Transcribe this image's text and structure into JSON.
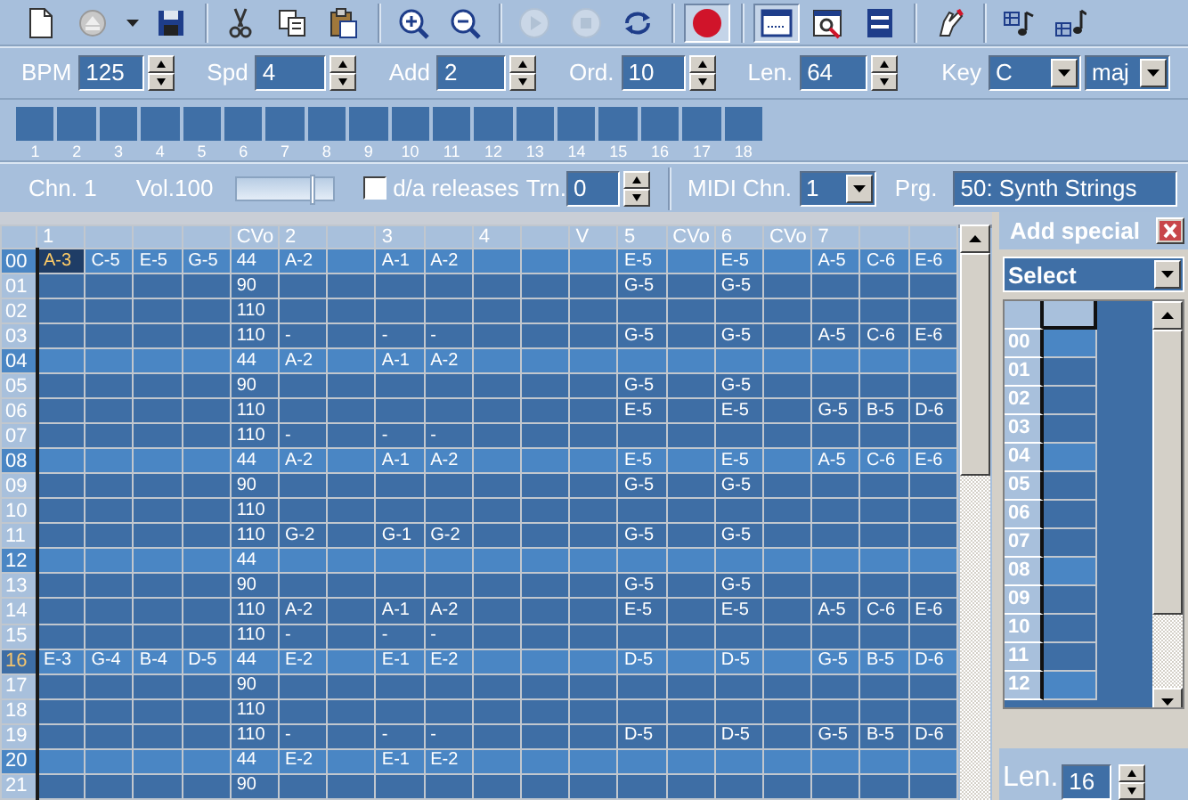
{
  "toolbar": {
    "groups": [
      {
        "buttons": [
          {
            "kind": "new",
            "pressed": false,
            "disabled": false
          },
          {
            "kind": "disc",
            "pressed": false,
            "disabled": false
          },
          {
            "kind": "caret",
            "pressed": false,
            "disabled": false
          },
          {
            "kind": "save",
            "pressed": false,
            "disabled": false
          }
        ]
      },
      {
        "buttons": [
          {
            "kind": "cut",
            "pressed": false,
            "disabled": false
          },
          {
            "kind": "copy",
            "pressed": false,
            "disabled": false
          },
          {
            "kind": "paste",
            "pressed": false,
            "disabled": false
          }
        ]
      },
      {
        "buttons": [
          {
            "kind": "zoom-in",
            "pressed": false,
            "disabled": false
          },
          {
            "kind": "zoom-out",
            "pressed": false,
            "disabled": false
          }
        ]
      },
      {
        "buttons": [
          {
            "kind": "play",
            "pressed": false,
            "disabled": true
          },
          {
            "kind": "stop",
            "pressed": false,
            "disabled": true
          },
          {
            "kind": "loop",
            "pressed": false,
            "disabled": false
          }
        ]
      },
      {
        "buttons": [
          {
            "kind": "record",
            "pressed": true,
            "disabled": false
          }
        ]
      },
      {
        "buttons": [
          {
            "kind": "pattern-view",
            "pressed": true,
            "disabled": false
          },
          {
            "kind": "window-search",
            "pressed": false,
            "disabled": false
          },
          {
            "kind": "list",
            "pressed": false,
            "disabled": false
          }
        ]
      },
      {
        "buttons": [
          {
            "kind": "hand",
            "pressed": false,
            "disabled": false
          }
        ]
      },
      {
        "buttons": [
          {
            "kind": "note",
            "pressed": false,
            "disabled": false
          },
          {
            "kind": "note-alt",
            "pressed": false,
            "disabled": false
          }
        ]
      }
    ]
  },
  "params": [
    {
      "kind": "spin",
      "label": "BPM",
      "value": "125"
    },
    {
      "kind": "spin",
      "label": "Spd",
      "value": "4"
    },
    {
      "kind": "spin",
      "label": "Add",
      "value": "2"
    },
    {
      "kind": "spin",
      "label": "Ord.",
      "value": "10"
    },
    {
      "kind": "spin",
      "label": "Len.",
      "value": "64"
    },
    {
      "kind": "select",
      "label": "Key",
      "value": "C"
    },
    {
      "kind": "select",
      "value": "maj"
    }
  ],
  "order_list": [
    "1",
    "2",
    "3",
    "4",
    "5",
    "6",
    "7",
    "8",
    "9",
    "10",
    "11",
    "12",
    "13",
    "14",
    "15",
    "16",
    "17",
    "18"
  ],
  "channel": {
    "label": "Chn. 1",
    "volume_label": "Vol.100",
    "volume": {
      "level": 0.82
    },
    "releases": {
      "label": "d/a releases",
      "checked": false
    },
    "transpose": {
      "label": "Trn.",
      "value": "0"
    },
    "midi_channel": {
      "label": "MIDI Chn.",
      "value": "1"
    },
    "program": {
      "label": "Prg.",
      "value": "50: Synth Strings"
    }
  },
  "pattern": {
    "columns": [
      {
        "label": "1"
      },
      {},
      {},
      {},
      {
        "label": "CVo"
      },
      {
        "label": "2"
      },
      {},
      {
        "label": "3"
      },
      {},
      {
        "label": "4"
      },
      {},
      {
        "label": "V"
      },
      {
        "label": "5"
      },
      {
        "label": "CVo"
      },
      {
        "label": "6"
      },
      {
        "label": "CVo"
      },
      {
        "label": "7"
      },
      {},
      {}
    ],
    "rows": [
      {
        "number": "00",
        "accent": true,
        "playing": false,
        "cells": [
          {
            "text": "A-3",
            "selected": true
          },
          {
            "text": "C-5",
            "selected": false
          },
          {
            "text": "E-5",
            "selected": false
          },
          {
            "text": "G-5",
            "selected": false
          },
          {
            "text": "44",
            "selected": false
          },
          {
            "text": "A-2",
            "selected": false
          },
          {
            "selected": false
          },
          {
            "text": "A-1",
            "selected": false
          },
          {
            "text": "A-2",
            "selected": false
          },
          {
            "selected": false
          },
          {
            "selected": false
          },
          {
            "selected": false
          },
          {
            "text": "E-5",
            "selected": false
          },
          {
            "selected": false
          },
          {
            "text": "E-5",
            "selected": false
          },
          {
            "selected": false
          },
          {
            "text": "A-5",
            "selected": false
          },
          {
            "text": "C-6",
            "selected": false
          },
          {
            "text": "E-6",
            "selected": false
          }
        ]
      },
      {
        "number": "01",
        "accent": false,
        "playing": false,
        "cells": [
          {
            "selected": false
          },
          {
            "selected": false
          },
          {
            "selected": false
          },
          {
            "selected": false
          },
          {
            "text": "90",
            "selected": false
          },
          {
            "selected": false
          },
          {
            "selected": false
          },
          {
            "selected": false
          },
          {
            "selected": false
          },
          {
            "selected": false
          },
          {
            "selected": false
          },
          {
            "selected": false
          },
          {
            "text": "G-5",
            "selected": false
          },
          {
            "selected": false
          },
          {
            "text": "G-5",
            "selected": false
          },
          {
            "selected": false
          },
          {
            "selected": false
          },
          {
            "selected": false
          },
          {
            "selected": false
          }
        ]
      },
      {
        "number": "02",
        "accent": false,
        "playing": false,
        "cells": [
          {
            "selected": false
          },
          {
            "selected": false
          },
          {
            "selected": false
          },
          {
            "selected": false
          },
          {
            "text": "110",
            "selected": false
          },
          {
            "selected": false
          },
          {
            "selected": false
          },
          {
            "selected": false
          },
          {
            "selected": false
          },
          {
            "selected": false
          },
          {
            "selected": false
          },
          {
            "selected": false
          },
          {
            "selected": false
          },
          {
            "selected": false
          },
          {
            "selected": false
          },
          {
            "selected": false
          },
          {
            "selected": false
          },
          {
            "selected": false
          },
          {
            "selected": false
          }
        ]
      },
      {
        "number": "03",
        "accent": false,
        "playing": false,
        "cells": [
          {
            "selected": false
          },
          {
            "selected": false
          },
          {
            "selected": false
          },
          {
            "selected": false
          },
          {
            "text": "110",
            "selected": false
          },
          {
            "text": "-",
            "selected": false
          },
          {
            "selected": false
          },
          {
            "text": "-",
            "selected": false
          },
          {
            "text": "-",
            "selected": false
          },
          {
            "selected": false
          },
          {
            "selected": false
          },
          {
            "selected": false
          },
          {
            "text": "G-5",
            "selected": false
          },
          {
            "selected": false
          },
          {
            "text": "G-5",
            "selected": false
          },
          {
            "selected": false
          },
          {
            "text": "A-5",
            "selected": false
          },
          {
            "text": "C-6",
            "selected": false
          },
          {
            "text": "E-6",
            "selected": false
          }
        ]
      },
      {
        "number": "04",
        "accent": true,
        "playing": false,
        "cells": [
          {
            "selected": false
          },
          {
            "selected": false
          },
          {
            "selected": false
          },
          {
            "selected": false
          },
          {
            "text": "44",
            "selected": false
          },
          {
            "text": "A-2",
            "selected": false
          },
          {
            "selected": false
          },
          {
            "text": "A-1",
            "selected": false
          },
          {
            "text": "A-2",
            "selected": false
          },
          {
            "selected": false
          },
          {
            "selected": false
          },
          {
            "selected": false
          },
          {
            "selected": false
          },
          {
            "selected": false
          },
          {
            "selected": false
          },
          {
            "selected": false
          },
          {
            "selected": false
          },
          {
            "selected": false
          },
          {
            "selected": false
          }
        ]
      },
      {
        "number": "05",
        "accent": false,
        "playing": false,
        "cells": [
          {
            "selected": false
          },
          {
            "selected": false
          },
          {
            "selected": false
          },
          {
            "selected": false
          },
          {
            "text": "90",
            "selected": false
          },
          {
            "selected": false
          },
          {
            "selected": false
          },
          {
            "selected": false
          },
          {
            "selected": false
          },
          {
            "selected": false
          },
          {
            "selected": false
          },
          {
            "selected": false
          },
          {
            "text": "G-5",
            "selected": false
          },
          {
            "selected": false
          },
          {
            "text": "G-5",
            "selected": false
          },
          {
            "selected": false
          },
          {
            "selected": false
          },
          {
            "selected": false
          },
          {
            "selected": false
          }
        ]
      },
      {
        "number": "06",
        "accent": false,
        "playing": false,
        "cells": [
          {
            "selected": false
          },
          {
            "selected": false
          },
          {
            "selected": false
          },
          {
            "selected": false
          },
          {
            "text": "110",
            "selected": false
          },
          {
            "selected": false
          },
          {
            "selected": false
          },
          {
            "selected": false
          },
          {
            "selected": false
          },
          {
            "selected": false
          },
          {
            "selected": false
          },
          {
            "selected": false
          },
          {
            "text": "E-5",
            "selected": false
          },
          {
            "selected": false
          },
          {
            "text": "E-5",
            "selected": false
          },
          {
            "selected": false
          },
          {
            "text": "G-5",
            "selected": false
          },
          {
            "text": "B-5",
            "selected": false
          },
          {
            "text": "D-6",
            "selected": false
          }
        ]
      },
      {
        "number": "07",
        "accent": false,
        "playing": false,
        "cells": [
          {
            "selected": false
          },
          {
            "selected": false
          },
          {
            "selected": false
          },
          {
            "selected": false
          },
          {
            "text": "110",
            "selected": false
          },
          {
            "text": "-",
            "selected": false
          },
          {
            "selected": false
          },
          {
            "text": "-",
            "selected": false
          },
          {
            "text": "-",
            "selected": false
          },
          {
            "selected": false
          },
          {
            "selected": false
          },
          {
            "selected": false
          },
          {
            "selected": false
          },
          {
            "selected": false
          },
          {
            "selected": false
          },
          {
            "selected": false
          },
          {
            "selected": false
          },
          {
            "selected": false
          },
          {
            "selected": false
          }
        ]
      },
      {
        "number": "08",
        "accent": true,
        "playing": false,
        "cells": [
          {
            "selected": false
          },
          {
            "selected": false
          },
          {
            "selected": false
          },
          {
            "selected": false
          },
          {
            "text": "44",
            "selected": false
          },
          {
            "text": "A-2",
            "selected": false
          },
          {
            "selected": false
          },
          {
            "text": "A-1",
            "selected": false
          },
          {
            "text": "A-2",
            "selected": false
          },
          {
            "selected": false
          },
          {
            "selected": false
          },
          {
            "selected": false
          },
          {
            "text": "E-5",
            "selected": false
          },
          {
            "selected": false
          },
          {
            "text": "E-5",
            "selected": false
          },
          {
            "selected": false
          },
          {
            "text": "A-5",
            "selected": false
          },
          {
            "text": "C-6",
            "selected": false
          },
          {
            "text": "E-6",
            "selected": false
          }
        ]
      },
      {
        "number": "09",
        "accent": false,
        "playing": false,
        "cells": [
          {
            "selected": false
          },
          {
            "selected": false
          },
          {
            "selected": false
          },
          {
            "selected": false
          },
          {
            "text": "90",
            "selected": false
          },
          {
            "selected": false
          },
          {
            "selected": false
          },
          {
            "selected": false
          },
          {
            "selected": false
          },
          {
            "selected": false
          },
          {
            "selected": false
          },
          {
            "selected": false
          },
          {
            "text": "G-5",
            "selected": false
          },
          {
            "selected": false
          },
          {
            "text": "G-5",
            "selected": false
          },
          {
            "selected": false
          },
          {
            "selected": false
          },
          {
            "selected": false
          },
          {
            "selected": false
          }
        ]
      },
      {
        "number": "10",
        "accent": false,
        "playing": false,
        "cells": [
          {
            "selected": false
          },
          {
            "selected": false
          },
          {
            "selected": false
          },
          {
            "selected": false
          },
          {
            "text": "110",
            "selected": false
          },
          {
            "selected": false
          },
          {
            "selected": false
          },
          {
            "selected": false
          },
          {
            "selected": false
          },
          {
            "selected": false
          },
          {
            "selected": false
          },
          {
            "selected": false
          },
          {
            "selected": false
          },
          {
            "selected": false
          },
          {
            "selected": false
          },
          {
            "selected": false
          },
          {
            "selected": false
          },
          {
            "selected": false
          },
          {
            "selected": false
          }
        ]
      },
      {
        "number": "11",
        "accent": false,
        "playing": false,
        "cells": [
          {
            "selected": false
          },
          {
            "selected": false
          },
          {
            "selected": false
          },
          {
            "selected": false
          },
          {
            "text": "110",
            "selected": false
          },
          {
            "text": "G-2",
            "selected": false
          },
          {
            "selected": false
          },
          {
            "text": "G-1",
            "selected": false
          },
          {
            "text": "G-2",
            "selected": false
          },
          {
            "selected": false
          },
          {
            "selected": false
          },
          {
            "selected": false
          },
          {
            "text": "G-5",
            "selected": false
          },
          {
            "selected": false
          },
          {
            "text": "G-5",
            "selected": false
          },
          {
            "selected": false
          },
          {
            "selected": false
          },
          {
            "selected": false
          },
          {
            "selected": false
          }
        ]
      },
      {
        "number": "12",
        "accent": true,
        "playing": false,
        "cells": [
          {
            "selected": false
          },
          {
            "selected": false
          },
          {
            "selected": false
          },
          {
            "selected": false
          },
          {
            "text": "44",
            "selected": false
          },
          {
            "selected": false
          },
          {
            "selected": false
          },
          {
            "selected": false
          },
          {
            "selected": false
          },
          {
            "selected": false
          },
          {
            "selected": false
          },
          {
            "selected": false
          },
          {
            "selected": false
          },
          {
            "selected": false
          },
          {
            "selected": false
          },
          {
            "selected": false
          },
          {
            "selected": false
          },
          {
            "selected": false
          },
          {
            "selected": false
          }
        ]
      },
      {
        "number": "13",
        "accent": false,
        "playing": false,
        "cells": [
          {
            "selected": false
          },
          {
            "selected": false
          },
          {
            "selected": false
          },
          {
            "selected": false
          },
          {
            "text": "90",
            "selected": false
          },
          {
            "selected": false
          },
          {
            "selected": false
          },
          {
            "selected": false
          },
          {
            "selected": false
          },
          {
            "selected": false
          },
          {
            "selected": false
          },
          {
            "selected": false
          },
          {
            "text": "G-5",
            "selected": false
          },
          {
            "selected": false
          },
          {
            "text": "G-5",
            "selected": false
          },
          {
            "selected": false
          },
          {
            "selected": false
          },
          {
            "selected": false
          },
          {
            "selected": false
          }
        ]
      },
      {
        "number": "14",
        "accent": false,
        "playing": false,
        "cells": [
          {
            "selected": false
          },
          {
            "selected": false
          },
          {
            "selected": false
          },
          {
            "selected": false
          },
          {
            "text": "110",
            "selected": false
          },
          {
            "text": "A-2",
            "selected": false
          },
          {
            "selected": false
          },
          {
            "text": "A-1",
            "selected": false
          },
          {
            "text": "A-2",
            "selected": false
          },
          {
            "selected": false
          },
          {
            "selected": false
          },
          {
            "selected": false
          },
          {
            "text": "E-5",
            "selected": false
          },
          {
            "selected": false
          },
          {
            "text": "E-5",
            "selected": false
          },
          {
            "selected": false
          },
          {
            "text": "A-5",
            "selected": false
          },
          {
            "text": "C-6",
            "selected": false
          },
          {
            "text": "E-6",
            "selected": false
          }
        ]
      },
      {
        "number": "15",
        "accent": false,
        "playing": false,
        "cells": [
          {
            "selected": false
          },
          {
            "selected": false
          },
          {
            "selected": false
          },
          {
            "selected": false
          },
          {
            "text": "110",
            "selected": false
          },
          {
            "text": "-",
            "selected": false
          },
          {
            "selected": false
          },
          {
            "text": "-",
            "selected": false
          },
          {
            "text": "-",
            "selected": false
          },
          {
            "selected": false
          },
          {
            "selected": false
          },
          {
            "selected": false
          },
          {
            "selected": false
          },
          {
            "selected": false
          },
          {
            "selected": false
          },
          {
            "selected": false
          },
          {
            "selected": false
          },
          {
            "selected": false
          },
          {
            "selected": false
          }
        ]
      },
      {
        "number": "16",
        "accent": true,
        "playing": true,
        "cells": [
          {
            "text": "E-3",
            "selected": false
          },
          {
            "text": "G-4",
            "selected": false
          },
          {
            "text": "B-4",
            "selected": false
          },
          {
            "text": "D-5",
            "selected": false
          },
          {
            "text": "44",
            "selected": false
          },
          {
            "text": "E-2",
            "selected": false
          },
          {
            "selected": false
          },
          {
            "text": "E-1",
            "selected": false
          },
          {
            "text": "E-2",
            "selected": false
          },
          {
            "selected": false
          },
          {
            "selected": false
          },
          {
            "selected": false
          },
          {
            "text": "D-5",
            "selected": false
          },
          {
            "selected": false
          },
          {
            "text": "D-5",
            "selected": false
          },
          {
            "selected": false
          },
          {
            "text": "G-5",
            "selected": false
          },
          {
            "text": "B-5",
            "selected": false
          },
          {
            "text": "D-6",
            "selected": false
          }
        ]
      },
      {
        "number": "17",
        "accent": false,
        "playing": false,
        "cells": [
          {
            "selected": false
          },
          {
            "selected": false
          },
          {
            "selected": false
          },
          {
            "selected": false
          },
          {
            "text": "90",
            "selected": false
          },
          {
            "selected": false
          },
          {
            "selected": false
          },
          {
            "selected": false
          },
          {
            "selected": false
          },
          {
            "selected": false
          },
          {
            "selected": false
          },
          {
            "selected": false
          },
          {
            "selected": false
          },
          {
            "selected": false
          },
          {
            "selected": false
          },
          {
            "selected": false
          },
          {
            "selected": false
          },
          {
            "selected": false
          },
          {
            "selected": false
          }
        ]
      },
      {
        "number": "18",
        "accent": false,
        "playing": false,
        "cells": [
          {
            "selected": false
          },
          {
            "selected": false
          },
          {
            "selected": false
          },
          {
            "selected": false
          },
          {
            "text": "110",
            "selected": false
          },
          {
            "selected": false
          },
          {
            "selected": false
          },
          {
            "selected": false
          },
          {
            "selected": false
          },
          {
            "selected": false
          },
          {
            "selected": false
          },
          {
            "selected": false
          },
          {
            "selected": false
          },
          {
            "selected": false
          },
          {
            "selected": false
          },
          {
            "selected": false
          },
          {
            "selected": false
          },
          {
            "selected": false
          },
          {
            "selected": false
          }
        ]
      },
      {
        "number": "19",
        "accent": false,
        "playing": false,
        "cells": [
          {
            "selected": false
          },
          {
            "selected": false
          },
          {
            "selected": false
          },
          {
            "selected": false
          },
          {
            "text": "110",
            "selected": false
          },
          {
            "text": "-",
            "selected": false
          },
          {
            "selected": false
          },
          {
            "text": "-",
            "selected": false
          },
          {
            "text": "-",
            "selected": false
          },
          {
            "selected": false
          },
          {
            "selected": false
          },
          {
            "selected": false
          },
          {
            "text": "D-5",
            "selected": false
          },
          {
            "selected": false
          },
          {
            "text": "D-5",
            "selected": false
          },
          {
            "selected": false
          },
          {
            "text": "G-5",
            "selected": false
          },
          {
            "text": "B-5",
            "selected": false
          },
          {
            "text": "D-6",
            "selected": false
          }
        ]
      },
      {
        "number": "20",
        "accent": true,
        "playing": false,
        "cells": [
          {
            "selected": false
          },
          {
            "selected": false
          },
          {
            "selected": false
          },
          {
            "selected": false
          },
          {
            "text": "44",
            "selected": false
          },
          {
            "text": "E-2",
            "selected": false
          },
          {
            "selected": false
          },
          {
            "text": "E-1",
            "selected": false
          },
          {
            "text": "E-2",
            "selected": false
          },
          {
            "selected": false
          },
          {
            "selected": false
          },
          {
            "selected": false
          },
          {
            "selected": false
          },
          {
            "selected": false
          },
          {
            "selected": false
          },
          {
            "selected": false
          },
          {
            "selected": false
          },
          {
            "selected": false
          },
          {
            "selected": false
          }
        ]
      },
      {
        "number": "21",
        "accent": false,
        "playing": false,
        "cells": [
          {
            "selected": false
          },
          {
            "selected": false
          },
          {
            "selected": false
          },
          {
            "selected": false
          },
          {
            "text": "90",
            "selected": false
          },
          {
            "selected": false
          },
          {
            "selected": false
          },
          {
            "selected": false
          },
          {
            "selected": false
          },
          {
            "selected": false
          },
          {
            "selected": false
          },
          {
            "selected": false
          },
          {
            "selected": false
          },
          {
            "selected": false
          },
          {
            "selected": false
          },
          {
            "selected": false
          },
          {
            "selected": false
          },
          {
            "selected": false
          },
          {
            "selected": false
          }
        ]
      }
    ]
  },
  "special_panel": {
    "title": "Add special",
    "select": {
      "value": "Select"
    },
    "rows": [
      {
        "number": "00",
        "accent": true
      },
      {
        "number": "01",
        "accent": false
      },
      {
        "number": "02",
        "accent": false
      },
      {
        "number": "03",
        "accent": false
      },
      {
        "number": "04",
        "accent": true
      },
      {
        "number": "05",
        "accent": false
      },
      {
        "number": "06",
        "accent": false
      },
      {
        "number": "07",
        "accent": false
      },
      {
        "number": "08",
        "accent": true
      },
      {
        "number": "09",
        "accent": false
      },
      {
        "number": "10",
        "accent": false
      },
      {
        "number": "11",
        "accent": false
      },
      {
        "number": "12",
        "accent": true
      }
    ],
    "length": {
      "label": "Len.",
      "value": "16"
    }
  }
}
